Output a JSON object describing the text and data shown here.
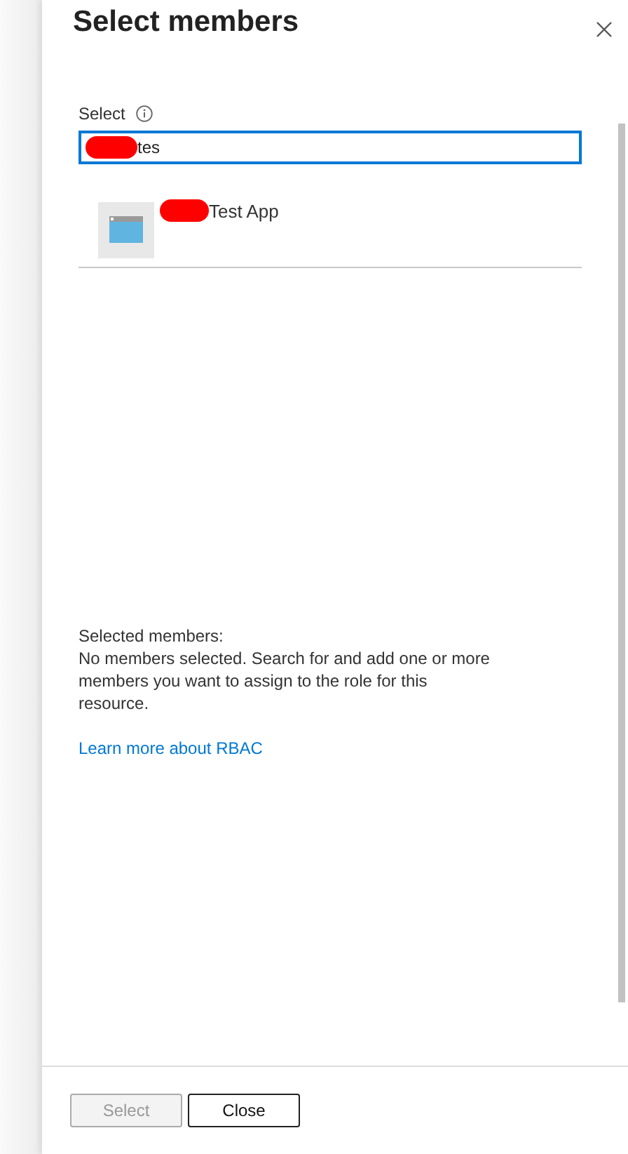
{
  "panel": {
    "title": "Select members"
  },
  "select_field": {
    "label": "Select",
    "value": "tes",
    "redacted": true,
    "focused": true
  },
  "results": [
    {
      "name": "Test App",
      "redacted": true,
      "selected": false
    }
  ],
  "selected_members": {
    "heading": "Selected members:",
    "message": "No members selected. Search for and add one or more members you want to assign to the role for this resource."
  },
  "link": "Learn more about RBAC",
  "buttons": [
    {
      "label": "Select",
      "disabled": true
    },
    {
      "label": "Close",
      "disabled": false
    }
  ]
}
